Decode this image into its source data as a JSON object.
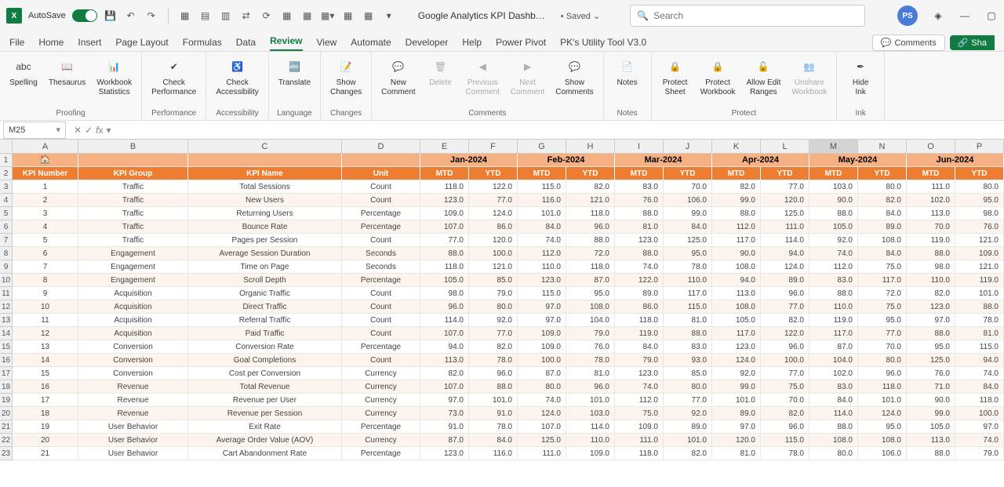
{
  "title_bar": {
    "autosave": "AutoSave",
    "doc_name": "Google Analytics KPI Dashb…",
    "saved": "Saved",
    "search_placeholder": "Search",
    "avatar": "PS"
  },
  "tabs": [
    "File",
    "Home",
    "Insert",
    "Page Layout",
    "Formulas",
    "Data",
    "Review",
    "View",
    "Automate",
    "Developer",
    "Help",
    "Power Pivot",
    "PK's Utility Tool V3.0"
  ],
  "active_tab": "Review",
  "comments_btn": "Comments",
  "share_btn": "Sha",
  "ribbon": {
    "groups": [
      {
        "title": "Proofing",
        "items": [
          {
            "label": "Spelling"
          },
          {
            "label": "Thesaurus"
          },
          {
            "label": "Workbook\nStatistics"
          }
        ]
      },
      {
        "title": "Performance",
        "items": [
          {
            "label": "Check\nPerformance"
          }
        ]
      },
      {
        "title": "Accessibility",
        "items": [
          {
            "label": "Check\nAccessibility"
          }
        ]
      },
      {
        "title": "Language",
        "items": [
          {
            "label": "Translate"
          }
        ]
      },
      {
        "title": "Changes",
        "items": [
          {
            "label": "Show\nChanges"
          }
        ]
      },
      {
        "title": "Comments",
        "items": [
          {
            "label": "New\nComment"
          },
          {
            "label": "Delete",
            "disabled": true
          },
          {
            "label": "Previous\nComment",
            "disabled": true
          },
          {
            "label": "Next\nComment",
            "disabled": true
          },
          {
            "label": "Show\nComments"
          }
        ]
      },
      {
        "title": "Notes",
        "items": [
          {
            "label": "Notes"
          }
        ]
      },
      {
        "title": "Protect",
        "items": [
          {
            "label": "Protect\nSheet"
          },
          {
            "label": "Protect\nWorkbook"
          },
          {
            "label": "Allow Edit\nRanges"
          },
          {
            "label": "Unshare\nWorkbook",
            "disabled": true
          }
        ]
      },
      {
        "title": "Ink",
        "items": [
          {
            "label": "Hide\nInk"
          }
        ]
      }
    ]
  },
  "name_box": "M25",
  "columns": [
    "A",
    "B",
    "C",
    "D",
    "E",
    "F",
    "G",
    "H",
    "I",
    "J",
    "K",
    "L",
    "M",
    "N",
    "O",
    "P"
  ],
  "selected_col": "M",
  "months": [
    "Jan-2024",
    "Feb-2024",
    "Mar-2024",
    "Apr-2024",
    "May-2024",
    "Jun-2024"
  ],
  "headers": [
    "KPI Number",
    "KPI Group",
    "KPI Name",
    "Unit",
    "MTD",
    "YTD",
    "MTD",
    "YTD",
    "MTD",
    "YTD",
    "MTD",
    "YTD",
    "MTD",
    "YTD",
    "MTD",
    "YTD"
  ],
  "rows": [
    {
      "n": 1,
      "g": "Traffic",
      "name": "Total Sessions",
      "unit": "Count",
      "v": [
        118.0,
        122.0,
        115.0,
        82.0,
        83.0,
        70.0,
        82.0,
        77.0,
        103.0,
        80.0,
        111.0,
        80.0
      ]
    },
    {
      "n": 2,
      "g": "Traffic",
      "name": "New Users",
      "unit": "Count",
      "v": [
        123.0,
        77.0,
        116.0,
        121.0,
        76.0,
        106.0,
        99.0,
        120.0,
        90.0,
        82.0,
        102.0,
        95.0
      ]
    },
    {
      "n": 3,
      "g": "Traffic",
      "name": "Returning Users",
      "unit": "Percentage",
      "v": [
        109.0,
        124.0,
        101.0,
        118.0,
        88.0,
        99.0,
        88.0,
        125.0,
        88.0,
        84.0,
        113.0,
        98.0
      ]
    },
    {
      "n": 4,
      "g": "Traffic",
      "name": "Bounce Rate",
      "unit": "Percentage",
      "v": [
        107.0,
        86.0,
        84.0,
        96.0,
        81.0,
        84.0,
        112.0,
        111.0,
        105.0,
        89.0,
        70.0,
        76.0
      ]
    },
    {
      "n": 5,
      "g": "Traffic",
      "name": "Pages per Session",
      "unit": "Count",
      "v": [
        77.0,
        120.0,
        74.0,
        88.0,
        123.0,
        125.0,
        117.0,
        114.0,
        92.0,
        108.0,
        119.0,
        121.0
      ]
    },
    {
      "n": 6,
      "g": "Engagement",
      "name": "Average Session Duration",
      "unit": "Seconds",
      "v": [
        88.0,
        100.0,
        112.0,
        72.0,
        88.0,
        95.0,
        90.0,
        94.0,
        74.0,
        84.0,
        88.0,
        109.0
      ]
    },
    {
      "n": 7,
      "g": "Engagement",
      "name": "Time on Page",
      "unit": "Seconds",
      "v": [
        118.0,
        121.0,
        110.0,
        118.0,
        74.0,
        78.0,
        108.0,
        124.0,
        112.0,
        75.0,
        98.0,
        121.0
      ]
    },
    {
      "n": 8,
      "g": "Engagement",
      "name": "Scroll Depth",
      "unit": "Percentage",
      "v": [
        105.0,
        85.0,
        123.0,
        87.0,
        122.0,
        110.0,
        94.0,
        89.0,
        83.0,
        117.0,
        110.0,
        119.0
      ]
    },
    {
      "n": 9,
      "g": "Acquisition",
      "name": "Organic Traffic",
      "unit": "Count",
      "v": [
        98.0,
        79.0,
        115.0,
        95.0,
        89.0,
        117.0,
        113.0,
        96.0,
        88.0,
        72.0,
        82.0,
        101.0
      ]
    },
    {
      "n": 10,
      "g": "Acquisition",
      "name": "Direct Traffic",
      "unit": "Count",
      "v": [
        96.0,
        80.0,
        97.0,
        108.0,
        86.0,
        115.0,
        108.0,
        77.0,
        110.0,
        75.0,
        123.0,
        88.0
      ]
    },
    {
      "n": 11,
      "g": "Acquisition",
      "name": "Referral Traffic",
      "unit": "Count",
      "v": [
        114.0,
        92.0,
        97.0,
        104.0,
        118.0,
        81.0,
        105.0,
        82.0,
        119.0,
        95.0,
        97.0,
        78.0
      ]
    },
    {
      "n": 12,
      "g": "Acquisition",
      "name": "Paid Traffic",
      "unit": "Count",
      "v": [
        107.0,
        77.0,
        109.0,
        79.0,
        119.0,
        88.0,
        117.0,
        122.0,
        117.0,
        77.0,
        88.0,
        81.0
      ]
    },
    {
      "n": 13,
      "g": "Conversion",
      "name": "Conversion Rate",
      "unit": "Percentage",
      "v": [
        94.0,
        82.0,
        109.0,
        76.0,
        84.0,
        83.0,
        123.0,
        96.0,
        87.0,
        70.0,
        95.0,
        115.0
      ]
    },
    {
      "n": 14,
      "g": "Conversion",
      "name": "Goal Completions",
      "unit": "Count",
      "v": [
        113.0,
        78.0,
        100.0,
        78.0,
        79.0,
        93.0,
        124.0,
        100.0,
        104.0,
        80.0,
        125.0,
        94.0
      ]
    },
    {
      "n": 15,
      "g": "Conversion",
      "name": "Cost per Conversion",
      "unit": "Currency",
      "v": [
        82.0,
        96.0,
        87.0,
        81.0,
        123.0,
        85.0,
        92.0,
        77.0,
        102.0,
        96.0,
        76.0,
        74.0
      ]
    },
    {
      "n": 16,
      "g": "Revenue",
      "name": "Total Revenue",
      "unit": "Currency",
      "v": [
        107.0,
        88.0,
        80.0,
        96.0,
        74.0,
        80.0,
        99.0,
        75.0,
        83.0,
        118.0,
        71.0,
        84.0
      ]
    },
    {
      "n": 17,
      "g": "Revenue",
      "name": "Revenue per User",
      "unit": "Currency",
      "v": [
        97.0,
        101.0,
        74.0,
        101.0,
        112.0,
        77.0,
        101.0,
        70.0,
        84.0,
        101.0,
        90.0,
        118.0
      ]
    },
    {
      "n": 18,
      "g": "Revenue",
      "name": "Revenue per Session",
      "unit": "Currency",
      "v": [
        73.0,
        91.0,
        124.0,
        103.0,
        75.0,
        92.0,
        89.0,
        82.0,
        114.0,
        124.0,
        99.0,
        100.0
      ]
    },
    {
      "n": 19,
      "g": "User Behavior",
      "name": "Exit Rate",
      "unit": "Percentage",
      "v": [
        91.0,
        78.0,
        107.0,
        114.0,
        109.0,
        89.0,
        97.0,
        96.0,
        88.0,
        95.0,
        105.0,
        97.0
      ]
    },
    {
      "n": 20,
      "g": "User Behavior",
      "name": "Average Order Value (AOV)",
      "unit": "Currency",
      "v": [
        87.0,
        84.0,
        125.0,
        110.0,
        111.0,
        101.0,
        120.0,
        115.0,
        108.0,
        108.0,
        113.0,
        74.0
      ]
    },
    {
      "n": 21,
      "g": "User Behavior",
      "name": "Cart Abandonment Rate",
      "unit": "Percentage",
      "v": [
        123.0,
        116.0,
        111.0,
        109.0,
        118.0,
        82.0,
        81.0,
        78.0,
        80.0,
        106.0,
        88.0,
        79.0
      ]
    }
  ]
}
